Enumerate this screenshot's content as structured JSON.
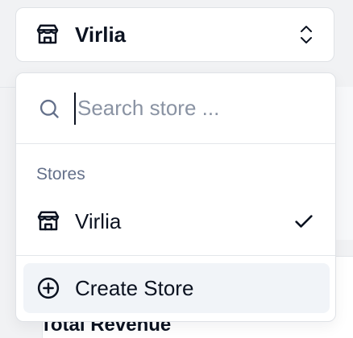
{
  "trigger": {
    "store_name": "Virlia",
    "icon": "store-icon",
    "chevron_icon": "chevrons-up-down-icon"
  },
  "search": {
    "placeholder": "Search store ...",
    "value": "",
    "icon": "search-icon"
  },
  "stores_group": {
    "label": "Stores",
    "items": [
      {
        "label": "Virlia",
        "icon": "store-icon",
        "selected": true
      }
    ]
  },
  "actions": {
    "create_label": "Create Store",
    "create_icon": "plus-circle-icon"
  },
  "background": {
    "card_title": "Total Revenue"
  },
  "colors": {
    "text": "#0b1220",
    "muted": "#64708a",
    "placeholder": "#8a93a3",
    "border": "#dfe2e6",
    "highlight": "#f1f4f8"
  }
}
